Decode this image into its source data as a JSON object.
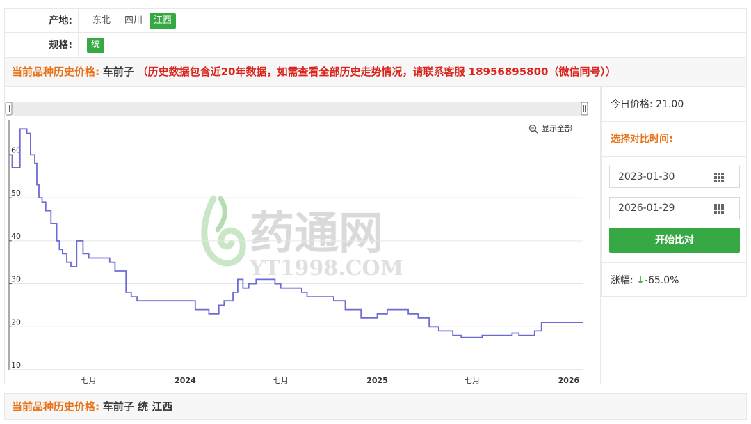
{
  "filters": {
    "origin_label": "产地:",
    "origin_options": [
      "东北",
      "四川",
      "江西"
    ],
    "origin_selected": "江西",
    "spec_label": "规格:",
    "spec_options": [
      "统"
    ],
    "spec_selected": "统"
  },
  "header": {
    "prefix": "当前品种历史价格:",
    "product": "车前子",
    "note": "（历史数据包含近20年数据，如需查看全部历史走势情况，请联系客服 18956895800（微信同号））"
  },
  "chart_toolbar": {
    "show_all": "显示全部"
  },
  "watermark": {
    "brand": "药通网",
    "domain": "YT1998.COM"
  },
  "side_panel": {
    "today_price_label": "今日价格:",
    "today_price": "21.00",
    "compare_label": "选择对比时间:",
    "date_start": "2023-01-30",
    "date_end": "2026-01-29",
    "start_button": "开始比对",
    "change_label": "涨幅:",
    "change_arrow": "↓",
    "change_value": "-65.0%"
  },
  "footer": {
    "prefix": "当前品种历史价格:",
    "product_spec": "车前子 统 江西"
  },
  "colors": {
    "accent_green": "#37a944",
    "label_orange": "#e8731a",
    "note_red": "#d9231b",
    "line_blue": "#6b6bd6"
  },
  "chart_data": {
    "type": "line",
    "step": true,
    "xlim": [
      "2023-01-30",
      "2026-01-29"
    ],
    "ylim": [
      10,
      68
    ],
    "y_ticks": [
      10,
      20,
      30,
      40,
      50,
      60
    ],
    "x_ticks": [
      {
        "date": "2023-07-01",
        "label": "七月",
        "bold": false
      },
      {
        "date": "2024-01-01",
        "label": "2024",
        "bold": true
      },
      {
        "date": "2024-07-01",
        "label": "七月",
        "bold": false
      },
      {
        "date": "2025-01-01",
        "label": "2025",
        "bold": true
      },
      {
        "date": "2025-07-01",
        "label": "七月",
        "bold": false
      },
      {
        "date": "2026-01-01",
        "label": "2026",
        "bold": true
      }
    ],
    "grid": true,
    "series": [
      {
        "points": [
          [
            "2023-01-30",
            60
          ],
          [
            "2023-02-05",
            57
          ],
          [
            "2023-02-20",
            66
          ],
          [
            "2023-03-05",
            65
          ],
          [
            "2023-03-12",
            60
          ],
          [
            "2023-03-20",
            58
          ],
          [
            "2023-03-24",
            53
          ],
          [
            "2023-03-28",
            50
          ],
          [
            "2023-04-03",
            49
          ],
          [
            "2023-04-10",
            47
          ],
          [
            "2023-04-20",
            44
          ],
          [
            "2023-05-01",
            40
          ],
          [
            "2023-05-06",
            38
          ],
          [
            "2023-05-12",
            37
          ],
          [
            "2023-05-20",
            35
          ],
          [
            "2023-05-28",
            34
          ],
          [
            "2023-06-08",
            40
          ],
          [
            "2023-06-20",
            37
          ],
          [
            "2023-07-01",
            36
          ],
          [
            "2023-08-10",
            35
          ],
          [
            "2023-08-20",
            33
          ],
          [
            "2023-09-10",
            28
          ],
          [
            "2023-09-20",
            27
          ],
          [
            "2023-10-01",
            26
          ],
          [
            "2024-01-20",
            24
          ],
          [
            "2024-02-15",
            23
          ],
          [
            "2024-03-05",
            25
          ],
          [
            "2024-03-15",
            26
          ],
          [
            "2024-04-01",
            28
          ],
          [
            "2024-04-10",
            31
          ],
          [
            "2024-04-20",
            29
          ],
          [
            "2024-05-01",
            30
          ],
          [
            "2024-05-15",
            31
          ],
          [
            "2024-06-20",
            30
          ],
          [
            "2024-07-01",
            29
          ],
          [
            "2024-08-10",
            28
          ],
          [
            "2024-08-20",
            27
          ],
          [
            "2024-10-10",
            26
          ],
          [
            "2024-11-01",
            24
          ],
          [
            "2024-12-01",
            22
          ],
          [
            "2025-01-01",
            23
          ],
          [
            "2025-01-20",
            24
          ],
          [
            "2025-03-01",
            23
          ],
          [
            "2025-03-20",
            22
          ],
          [
            "2025-04-10",
            20
          ],
          [
            "2025-04-28",
            19
          ],
          [
            "2025-05-25",
            18
          ],
          [
            "2025-06-10",
            17.5
          ],
          [
            "2025-07-20",
            18
          ],
          [
            "2025-09-15",
            18.5
          ],
          [
            "2025-09-28",
            18
          ],
          [
            "2025-10-28",
            19
          ],
          [
            "2025-11-10",
            21
          ],
          [
            "2026-01-29",
            21
          ]
        ]
      }
    ]
  }
}
